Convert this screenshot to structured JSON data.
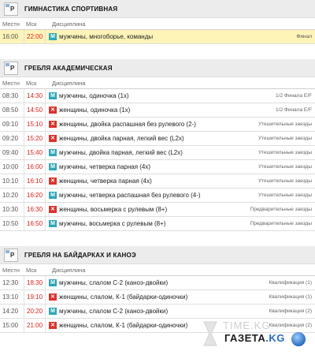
{
  "columns": {
    "local": "Местн",
    "msk": "Мск",
    "discipline": "Дисциплина"
  },
  "sections": [
    {
      "title": "ГИМНАСТИКА СПОРТИВНАЯ",
      "icon": "image-placeholder-icon",
      "icon_letter": "P",
      "rows": [
        {
          "local": "16:00",
          "msk": "22:00",
          "gender": "М",
          "discipline": "мужчины, многоборье, команды",
          "stage": "Финал",
          "highlight": true
        }
      ]
    },
    {
      "title": "ГРЕБЛЯ АКАДЕМИЧЕСКАЯ",
      "icon": "image-placeholder-icon",
      "icon_letter": "P",
      "rows": [
        {
          "local": "08:30",
          "msk": "14:30",
          "gender": "М",
          "discipline": "мужчины, одиночка (1х)",
          "stage": "1/2 Финала E/F"
        },
        {
          "local": "08:50",
          "msk": "14:50",
          "gender": "Ж",
          "discipline": "женщины, одиночка (1х)",
          "stage": "1/2 Финала E/F"
        },
        {
          "local": "09:10",
          "msk": "15:10",
          "gender": "Ж",
          "discipline": "женщины, двойка распашная без рулевого (2-)",
          "stage": "Утешительные заезды"
        },
        {
          "local": "09:20",
          "msk": "15:20",
          "gender": "Ж",
          "discipline": "женщины, двойка парная, легкий вес (L2x)",
          "stage": "Утешительные заезды"
        },
        {
          "local": "09:40",
          "msk": "15:40",
          "gender": "М",
          "discipline": "мужчины, двойка парная, легкий вес (L2x)",
          "stage": "Утешительные заезды"
        },
        {
          "local": "10:00",
          "msk": "16:00",
          "gender": "М",
          "discipline": "мужчины, четверка парная (4х)",
          "stage": "Утешительные заезды"
        },
        {
          "local": "10:10",
          "msk": "16:10",
          "gender": "Ж",
          "discipline": "женщины, четверка парная (4х)",
          "stage": "Утешительные заезды"
        },
        {
          "local": "10:20",
          "msk": "16:20",
          "gender": "М",
          "discipline": "мужчины, четверка распашная без рулевого (4-)",
          "stage": "Утешительные заезды"
        },
        {
          "local": "10:30",
          "msk": "16:30",
          "gender": "Ж",
          "discipline": "женщины, восьмерка с рулевым (8+)",
          "stage": "Предварительные заезды"
        },
        {
          "local": "10:50",
          "msk": "16:50",
          "gender": "М",
          "discipline": "мужчины, восьмерка с рулевым (8+)",
          "stage": "Предварительные заезды"
        }
      ]
    },
    {
      "title": "ГРЕБЛЯ НА БАЙДАРКАХ И КАНОЭ",
      "icon": "image-placeholder-icon",
      "icon_letter": "P",
      "rows": [
        {
          "local": "12:30",
          "msk": "18:30",
          "gender": "М",
          "discipline": "мужчины, слалом С-2 (каноэ-двойки)",
          "stage": "Квалификация (1)"
        },
        {
          "local": "13:10",
          "msk": "19:10",
          "gender": "Ж",
          "discipline": "женщины, слалом, К-1 (байдарки-одиночки)",
          "stage": "Квалификация (1)"
        },
        {
          "local": "14:20",
          "msk": "20:20",
          "gender": "М",
          "discipline": "мужчины, слалом С-2 (каноэ-двойки)",
          "stage": "Квалификация (2)"
        },
        {
          "local": "15:00",
          "msk": "21:00",
          "gender": "Ж",
          "discipline": "женщины, слалом, К-1 (байдарки-одиночки)",
          "stage": "Квалификация (2)"
        }
      ]
    }
  ],
  "colors": {
    "male_badge": "#2fa7b5",
    "female_badge": "#d9342b",
    "msk_time": "#d72222",
    "highlight_row": "#fff4b8"
  },
  "watermark": {
    "site": "TIME.KG",
    "logo_main": "ГАЗЕТА",
    "logo_suffix": ".KG"
  }
}
